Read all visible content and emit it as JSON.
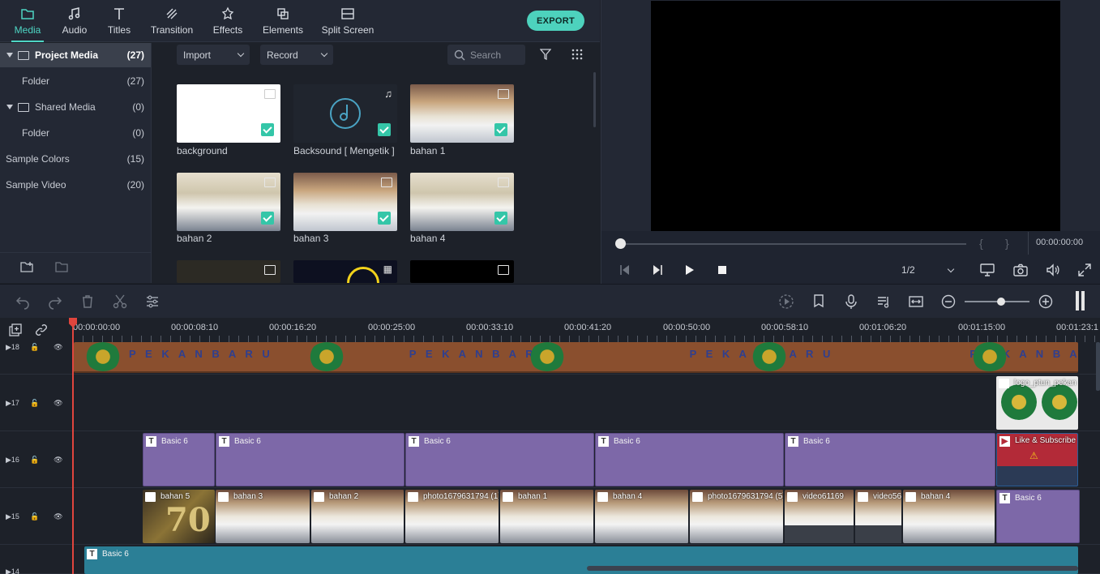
{
  "nav": {
    "tabs": [
      {
        "label": "Media",
        "icon": "folder-icon"
      },
      {
        "label": "Audio",
        "icon": "music-note-icon"
      },
      {
        "label": "Titles",
        "icon": "text-t-icon"
      },
      {
        "label": "Transition",
        "icon": "transition-icon"
      },
      {
        "label": "Effects",
        "icon": "effects-icon"
      },
      {
        "label": "Elements",
        "icon": "elements-icon"
      },
      {
        "label": "Split Screen",
        "icon": "split-screen-icon"
      }
    ],
    "active": "Media",
    "export_label": "EXPORT"
  },
  "sidebar": {
    "items": [
      {
        "label": "Project Media",
        "count": "(27)"
      },
      {
        "label": "Folder",
        "count": "(27)"
      },
      {
        "label": "Shared Media",
        "count": "(0)"
      },
      {
        "label": "Folder",
        "count": "(0)"
      },
      {
        "label": "Sample Colors",
        "count": "(15)"
      },
      {
        "label": "Sample Video",
        "count": "(20)"
      }
    ]
  },
  "media": {
    "import_label": "Import",
    "record_label": "Record",
    "search_placeholder": "Search",
    "items": [
      {
        "name": "background"
      },
      {
        "name": "Backsound [ Mengetik ]"
      },
      {
        "name": "bahan 1"
      },
      {
        "name": "bahan 2"
      },
      {
        "name": "bahan 3"
      },
      {
        "name": "bahan 4"
      }
    ]
  },
  "preview": {
    "timecode": "00:00:00:00",
    "zoom": "1/2",
    "bracket_in": "{",
    "bracket_out": "}"
  },
  "timeline": {
    "ruler": [
      "00:00:00:00",
      "00:00:08:10",
      "00:00:16:20",
      "00:00:25:00",
      "00:00:33:10",
      "00:00:41:20",
      "00:00:50:00",
      "00:00:58:10",
      "00:01:06:20",
      "00:01:15:00",
      "00:01:23:1"
    ],
    "tracks": [
      "18",
      "17",
      "16",
      "15",
      "14"
    ],
    "banner_text": "P E K A N B A R U",
    "logo_clip": "logo_ptun_pekan",
    "subscribe_clip": "Like & Subscribe",
    "title_clip": "Basic 6",
    "video_clips": [
      "bahan 5",
      "bahan 3",
      "bahan 2",
      "photo1679631794 (1)",
      "bahan 1",
      "bahan 4",
      "photo1679631794 (5)",
      "video61169",
      "video56",
      "bahan 4"
    ]
  },
  "colors": {
    "accent": "#4ed6c4",
    "title_clip": "#7d68a8",
    "playhead": "#e0453d",
    "track14": "#2b7f96"
  }
}
